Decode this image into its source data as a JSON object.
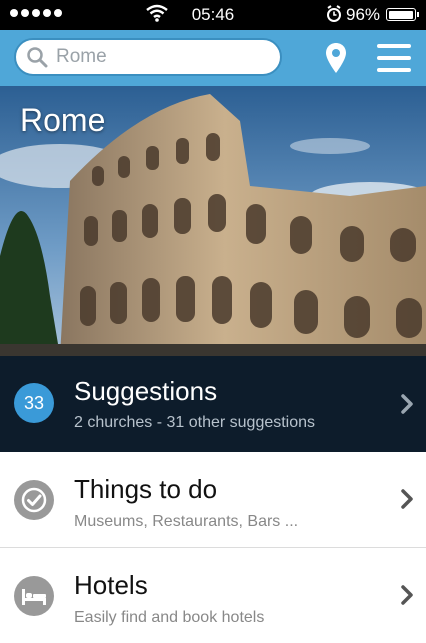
{
  "status_bar": {
    "time": "05:46",
    "battery": "96%",
    "battery_level": 0.96
  },
  "search": {
    "placeholder": "Rome"
  },
  "hero": {
    "city": "Rome"
  },
  "suggestions": {
    "count": "33",
    "title": "Suggestions",
    "subtitle": "2 churches - 31 other suggestions"
  },
  "list": [
    {
      "title": "Things to do",
      "subtitle": "Museums, Restaurants, Bars ...",
      "icon": "check-icon"
    },
    {
      "title": "Hotels",
      "subtitle": "Easily find and book hotels",
      "icon": "bed-icon"
    }
  ],
  "colors": {
    "accent": "#4fa7d8",
    "badge": "#3a9ad8",
    "dark_panel": "#0d1c2b"
  }
}
